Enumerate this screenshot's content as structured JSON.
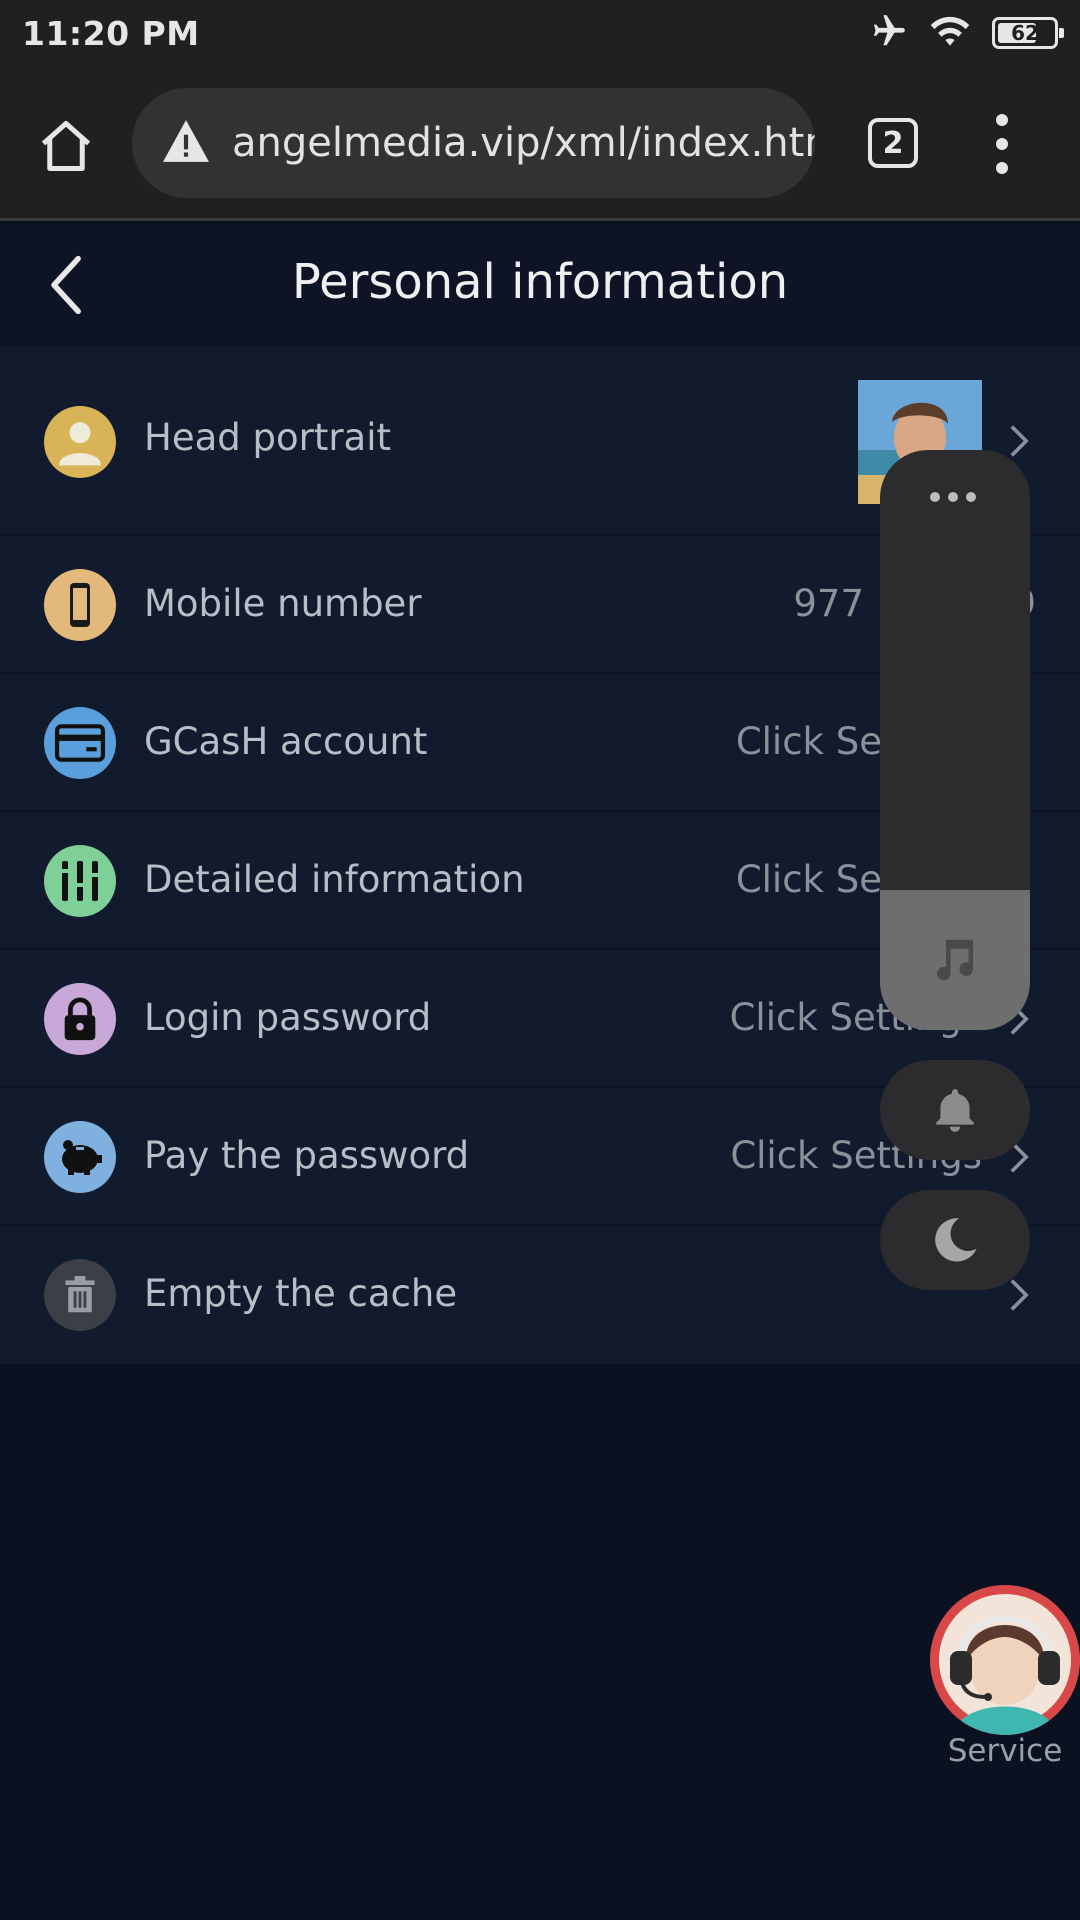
{
  "status_bar": {
    "time": "11:20 PM",
    "battery": "62",
    "icons": [
      "airplane-icon",
      "wifi-icon",
      "battery-icon"
    ]
  },
  "browser": {
    "url": "angelmedia.vip/xml/index.htm",
    "tab_count": "2",
    "icons": [
      "home-icon",
      "warning-icon",
      "tabs-icon",
      "more-vertical-icon"
    ]
  },
  "header": {
    "title": "Personal information",
    "back_icon": "chevron-left-icon"
  },
  "rows": [
    {
      "label": "Head portrait",
      "value": "",
      "icon": "user-silhouette-icon",
      "icon_color": "#d9b457"
    },
    {
      "label": "Mobile number",
      "value": "977",
      "value_tail": "9",
      "icon": "phone-icon",
      "icon_color": "#e2b97a"
    },
    {
      "label": "GCasH account",
      "value": "Click Se",
      "icon": "card-icon",
      "icon_color": "#5a9fdc"
    },
    {
      "label": "Detailed information",
      "value": "Click Se",
      "icon": "sliders-icon",
      "icon_color": "#7fcf99"
    },
    {
      "label": "Login password",
      "value": "Click Setting",
      "icon": "lock-icon",
      "icon_color": "#c8a8d8"
    },
    {
      "label": "Pay the password",
      "value": "Click Settings",
      "icon": "piggy-bank-icon",
      "icon_color": "#7fb0e0"
    },
    {
      "label": "Empty the cache",
      "value": "",
      "icon": "trash-icon",
      "icon_color": "#3c3f47"
    }
  ],
  "floating_toolbar": {
    "icons": [
      "more-horizontal-icon",
      "music-note-icon",
      "bell-icon",
      "moon-icon"
    ]
  },
  "service": {
    "label": "Service",
    "icon": "customer-service-agent-icon",
    "accent": "#d94848"
  },
  "colors": {
    "page_bg": "#0b1120",
    "header_bg": "#0e1426",
    "list_bg": "#121a2e",
    "browser_bg": "#202020"
  }
}
